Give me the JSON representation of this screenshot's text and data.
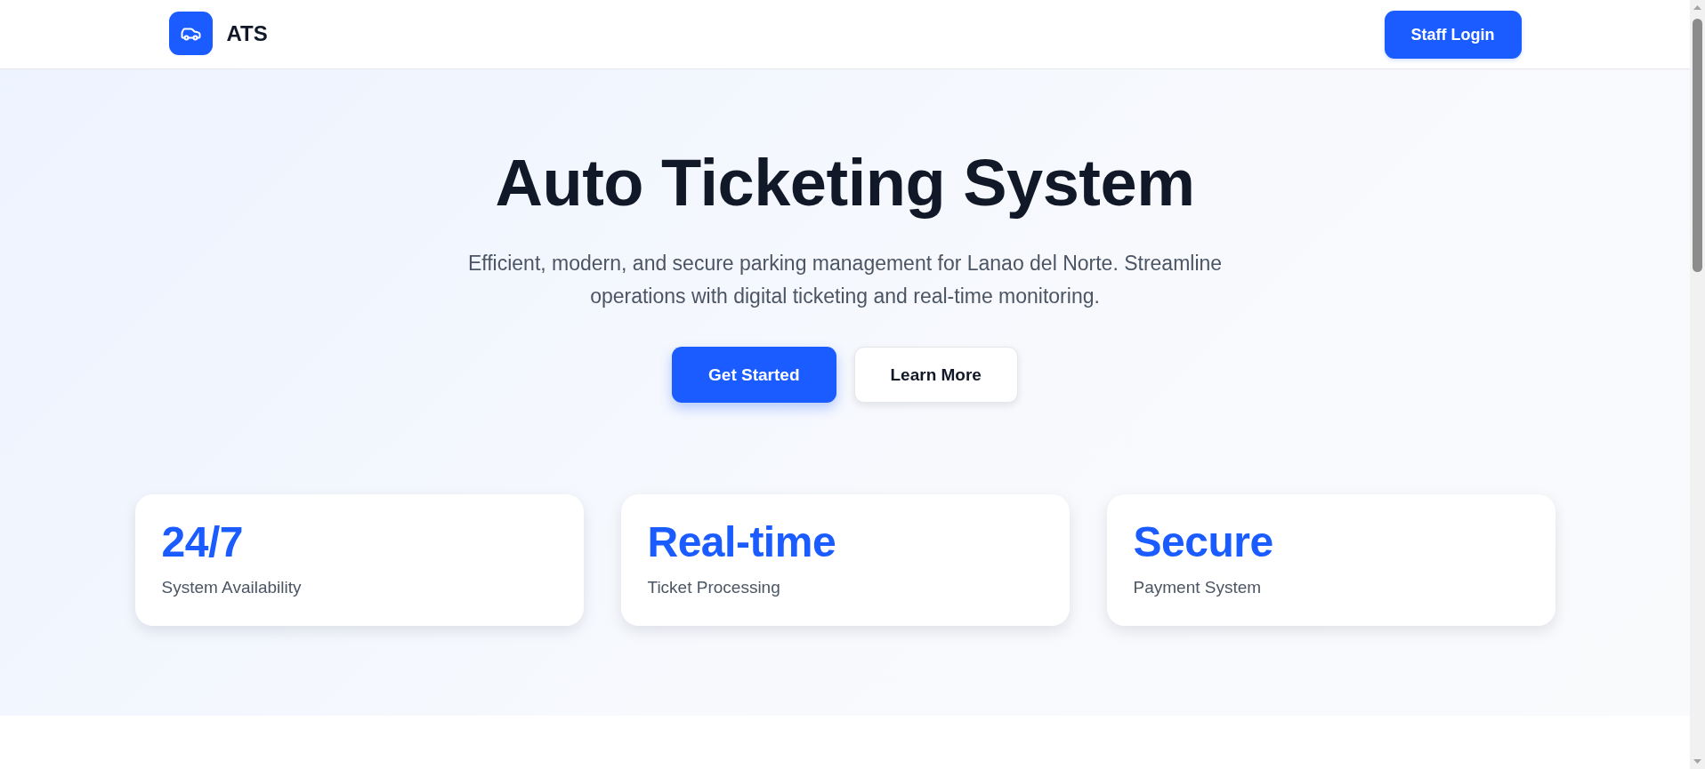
{
  "header": {
    "logo_text": "ATS",
    "login_button": "Staff Login"
  },
  "hero": {
    "title": "Auto Ticketing System",
    "subtitle": "Efficient, modern, and secure parking management for Lanao del Norte. Streamline operations with digital ticketing and real-time monitoring.",
    "buttons": [
      {
        "label": "Get Started",
        "kind": "primary"
      },
      {
        "label": "Learn More",
        "kind": "secondary"
      }
    ]
  },
  "stats": [
    {
      "value": "24/7",
      "label": "System Availability"
    },
    {
      "value": "Real-time",
      "label": "Ticket Processing"
    },
    {
      "value": "Secure",
      "label": "Payment System"
    }
  ]
}
